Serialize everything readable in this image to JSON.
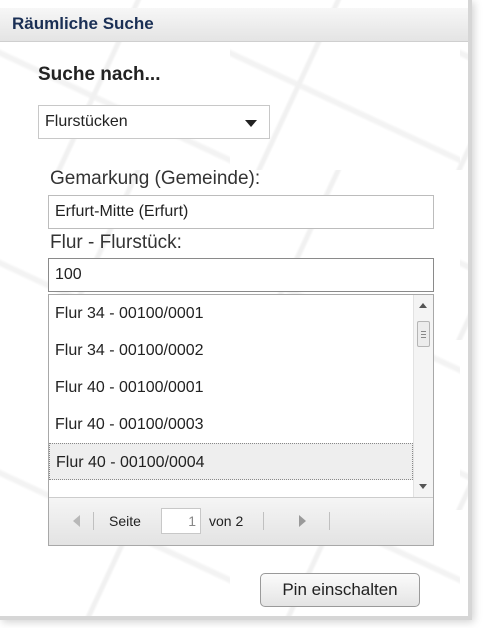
{
  "window": {
    "title": "Räumliche Suche"
  },
  "search": {
    "heading": "Suche nach...",
    "type_selected": "Flurstücken"
  },
  "gemarkung": {
    "label": "Gemarkung (Gemeinde):",
    "value": "Erfurt-Mitte (Erfurt)"
  },
  "flur": {
    "label": "Flur - Flurstück:",
    "value": "100"
  },
  "results": {
    "items": [
      "Flur 34 - 00100/0001",
      "Flur 34 - 00100/0002",
      "Flur 40 - 00100/0001",
      "Flur 40 - 00100/0003",
      "Flur 40 - 00100/0004"
    ],
    "selected_index": 4
  },
  "pager": {
    "page_label": "Seite",
    "current_page": "1",
    "of_label": "von 2"
  },
  "pin_button": {
    "label": "Pin einschalten"
  }
}
